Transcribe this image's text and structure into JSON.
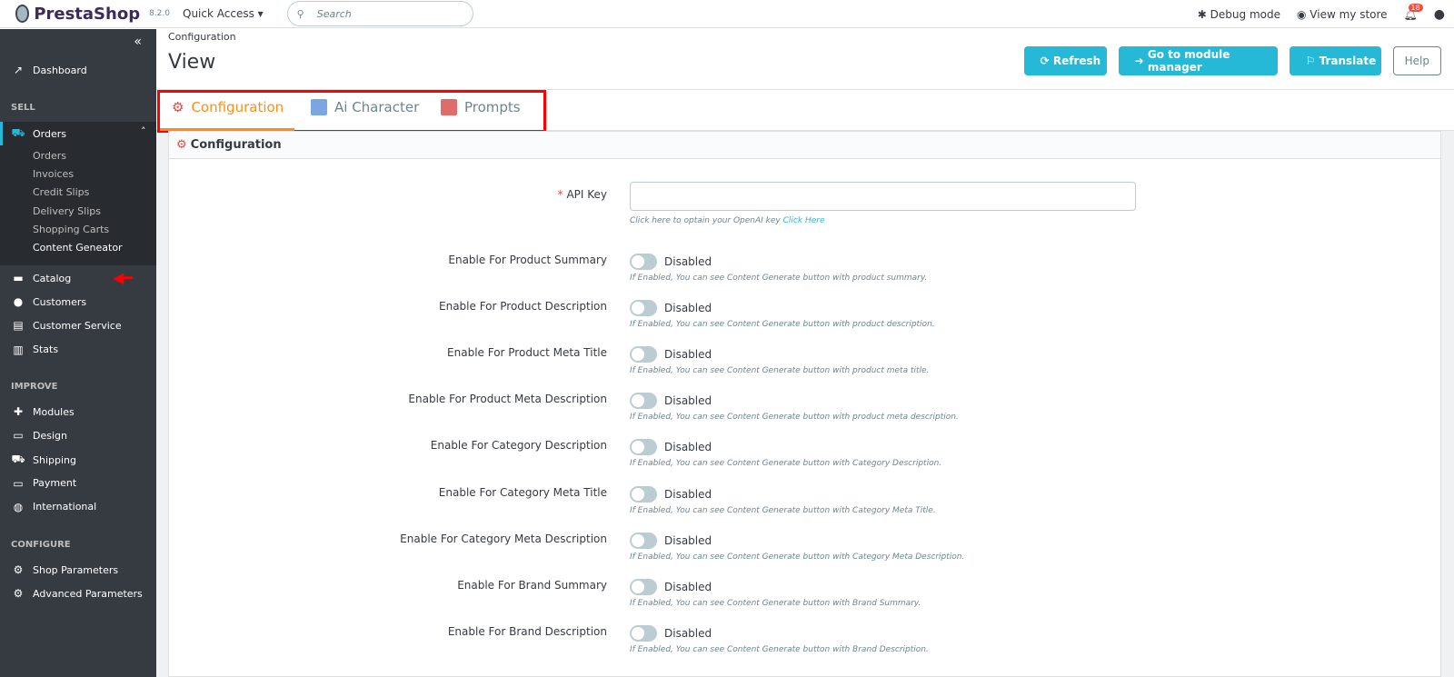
{
  "header": {
    "brand": "PrestaShop",
    "version": "8.2.0",
    "quick_access": "Quick Access ▾",
    "search_placeholder": "Search",
    "debug": "Debug mode",
    "view_store": "View my store",
    "notif_count": "18"
  },
  "sidebar": {
    "dashboard": "Dashboard",
    "sell": "SELL",
    "orders": "Orders",
    "orders_sub": [
      "Orders",
      "Invoices",
      "Credit Slips",
      "Delivery Slips",
      "Shopping Carts",
      "Content Geneator"
    ],
    "sell_items": [
      "Catalog",
      "Customers",
      "Customer Service",
      "Stats"
    ],
    "improve": "IMPROVE",
    "improve_items": [
      "Modules",
      "Design",
      "Shipping",
      "Payment",
      "International"
    ],
    "configure": "CONFIGURE",
    "configure_items": [
      "Shop Parameters",
      "Advanced Parameters"
    ]
  },
  "page": {
    "breadcrumb": "Configuration",
    "title": "View",
    "buttons": {
      "refresh": "Refresh",
      "module_manager": "Go to module manager",
      "translate": "Translate",
      "help": "Help"
    }
  },
  "tabs": [
    {
      "label": "Configuration",
      "active": true
    },
    {
      "label": "Ai Character"
    },
    {
      "label": "Prompts"
    }
  ],
  "form": {
    "panel_title": "Configuration",
    "api_key": {
      "label": "API Key",
      "value": "",
      "help": "Click here to optain your OpenAI key",
      "link": "Click Here"
    },
    "toggles": [
      {
        "label": "Enable For Product Summary",
        "state": "Disabled",
        "help": "If Enabled, You can see Content Generate button with product summary."
      },
      {
        "label": "Enable For Product Description",
        "state": "Disabled",
        "help": "If Enabled, You can see Content Generate button with product description."
      },
      {
        "label": "Enable For Product Meta Title",
        "state": "Disabled",
        "help": "If Enabled, You can see Content Generate button with product meta title."
      },
      {
        "label": "Enable For Product Meta Description",
        "state": "Disabled",
        "help": "If Enabled, You can see Content Generate button with product meta description."
      },
      {
        "label": "Enable For Category Description",
        "state": "Disabled",
        "help": "If Enabled, You can see Content Generate button with Category Description."
      },
      {
        "label": "Enable For Category Meta Title",
        "state": "Disabled",
        "help": "If Enabled, You can see Content Generate button with Category Meta Title."
      },
      {
        "label": "Enable For Category Meta Description",
        "state": "Disabled",
        "help": "If Enabled, You can see Content Generate button with Category Meta Description."
      },
      {
        "label": "Enable For Brand Summary",
        "state": "Disabled",
        "help": "If Enabled, You can see Content Generate button with Brand Summary."
      },
      {
        "label": "Enable For Brand Description",
        "state": "Disabled",
        "help": "If Enabled, You can see Content Generate button with Brand Description."
      }
    ]
  },
  "colors": {
    "accent": "#25b9d7",
    "active_tab": "#fd8d17",
    "sidebar": "#363a41",
    "highlight": "#ff0000"
  }
}
